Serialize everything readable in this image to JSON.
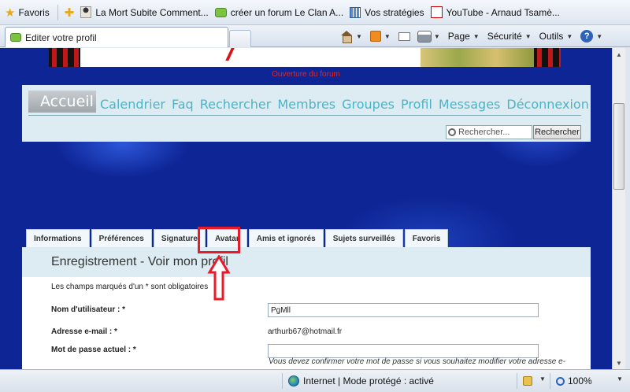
{
  "favorites_bar": {
    "favoris_label": "Favoris",
    "links": [
      {
        "label": "La Mort Subite  Comment..."
      },
      {
        "label": "créer un forum  Le Clan A..."
      },
      {
        "label": "Vos stratégies"
      },
      {
        "label": "YouTube - Arnaud Tsamè..."
      }
    ]
  },
  "tab": {
    "title": "Editer votre profil"
  },
  "toolbar": {
    "page_label": "Page",
    "securite_label": "Sécurité",
    "outils_label": "Outils"
  },
  "forum": {
    "banner_text": "Ouverture du forum",
    "nav": {
      "accueil": "Accueil",
      "links": [
        "Calendrier",
        "Faq",
        "Rechercher",
        "Membres",
        "Groupes",
        "Profil",
        "Messages",
        "Déconnexion"
      ]
    },
    "search": {
      "placeholder": "Rechercher...",
      "button": "Rechercher"
    },
    "profile_tabs": [
      "Informations",
      "Préférences",
      "Signature",
      "Avatar",
      "Amis et ignorés",
      "Sujets surveillés",
      "Favoris"
    ],
    "form": {
      "title": "Enregistrement - Voir mon profil",
      "required_note": "Les champs marqués d'un * sont obligatoires",
      "username_label": "Nom d'utilisateur : *",
      "username_value": "PgMll",
      "email_label": "Adresse e-mail : *",
      "email_value": "arthurb67@hotmail.fr",
      "password_label": "Mot de passe actuel : *",
      "password_value": "",
      "password_hint": "Vous devez confirmer votre mot de passe si vous souhaitez modifier votre adresse e-"
    }
  },
  "status_bar": {
    "zone": "Internet | Mode protégé : activé",
    "zoom": "100%"
  },
  "colors": {
    "callout": "#e81b2b",
    "nav_link": "#4db3c6",
    "forum_background": "#0e2596"
  }
}
